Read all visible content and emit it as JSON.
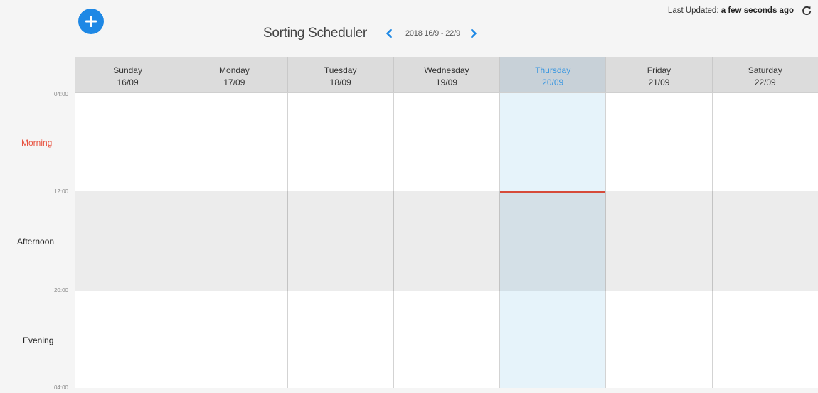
{
  "app": {
    "title": "Sorting Scheduler",
    "date_range": "2018 16/9 - 22/9",
    "last_updated_label": "Last Updated:",
    "last_updated_value": "a few seconds ago",
    "icons": {
      "add": "plus-icon",
      "prev": "chevron-left-icon",
      "next": "chevron-right-icon",
      "refresh": "refresh-icon"
    },
    "accent_color": "#1e88e5",
    "now_line_color": "#e8523f"
  },
  "days": [
    {
      "name": "Sunday",
      "date": "16/09",
      "today": false
    },
    {
      "name": "Monday",
      "date": "17/09",
      "today": false
    },
    {
      "name": "Tuesday",
      "date": "18/09",
      "today": false
    },
    {
      "name": "Wednesday",
      "date": "19/09",
      "today": false
    },
    {
      "name": "Thursday",
      "date": "20/09",
      "today": true
    },
    {
      "name": "Friday",
      "date": "21/09",
      "today": false
    },
    {
      "name": "Saturday",
      "date": "22/09",
      "today": false
    }
  ],
  "time_labels": {
    "t0": "04:00",
    "t1": "12:00",
    "t2": "20:00",
    "t3": "04:00"
  },
  "periods": {
    "morning": "Morning",
    "afternoon": "Afternoon",
    "evening": "Evening"
  }
}
